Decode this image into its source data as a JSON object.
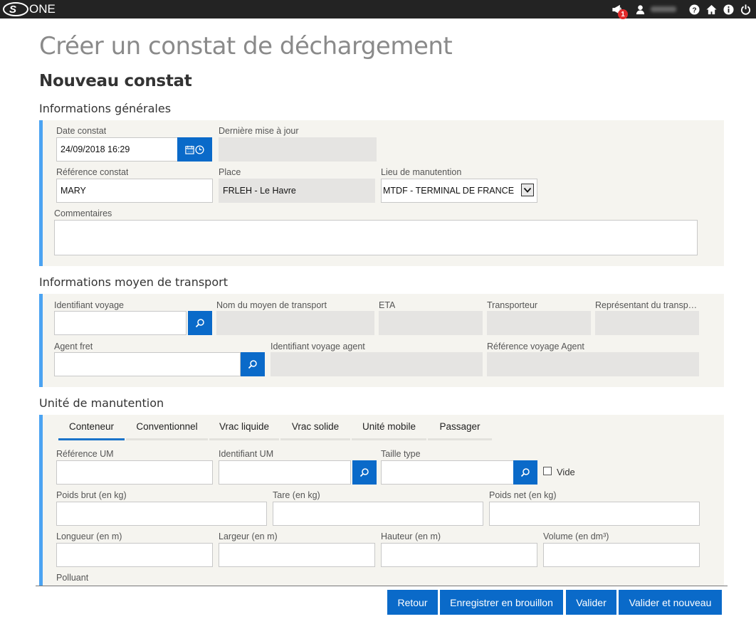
{
  "app": {
    "logo_text": "ONE",
    "notification_count": "1"
  },
  "page": {
    "title": "Créer un constat de déchargement",
    "subtitle": "Nouveau constat"
  },
  "general": {
    "section_title": "Informations générales",
    "date_label": "Date constat",
    "date_value": "24/09/2018 16:29",
    "last_update_label": "Dernière mise à jour",
    "last_update_value": "",
    "reference_label": "Référence constat",
    "reference_value": "MARY",
    "place_label": "Place",
    "place_value": "FRLEH - Le Havre",
    "handling_place_label": "Lieu de manutention",
    "handling_place_value": "MTDF - TERMINAL DE FRANCE",
    "comments_label": "Commentaires",
    "comments_value": ""
  },
  "transport": {
    "section_title": "Informations moyen de transport",
    "voyage_id_label": "Identifiant voyage",
    "means_name_label": "Nom du moyen de transport",
    "eta_label": "ETA",
    "carrier_label": "Transporteur",
    "carrier_rep_label": "Représentant du transp…",
    "freight_agent_label": "Agent fret",
    "agent_voyage_id_label": "Identifiant voyage agent",
    "agent_voyage_ref_label": "Référence voyage Agent"
  },
  "unit": {
    "section_title": "Unité de manutention",
    "tabs": [
      "Conteneur",
      "Conventionnel",
      "Vrac liquide",
      "Vrac solide",
      "Unité mobile",
      "Passager"
    ],
    "active_tab": "Conteneur",
    "ref_um_label": "Référence UM",
    "id_um_label": "Identifiant UM",
    "size_type_label": "Taille type",
    "empty_label": "Vide",
    "gross_weight_label": "Poids brut (en kg)",
    "tare_label": "Tare (en kg)",
    "net_weight_label": "Poids net (en kg)",
    "length_label": "Longueur (en m)",
    "width_label": "Largeur (en m)",
    "height_label": "Hauteur (en m)",
    "volume_label": "Volume (en dm³)",
    "pollutant_label": "Polluant"
  },
  "footer": {
    "back": "Retour",
    "save_draft": "Enregistrer en brouillon",
    "validate": "Valider",
    "validate_new": "Valider et nouveau"
  },
  "colors": {
    "accent": "#0a6ac9",
    "panel_border": "#4ba3f2",
    "badge": "#e12a2a"
  },
  "icons": [
    "megaphone-icon",
    "user-icon",
    "help-icon",
    "home-icon",
    "info-icon",
    "power-icon",
    "calendar-icon",
    "clock-icon",
    "search-icon",
    "chevron-down-icon"
  ]
}
